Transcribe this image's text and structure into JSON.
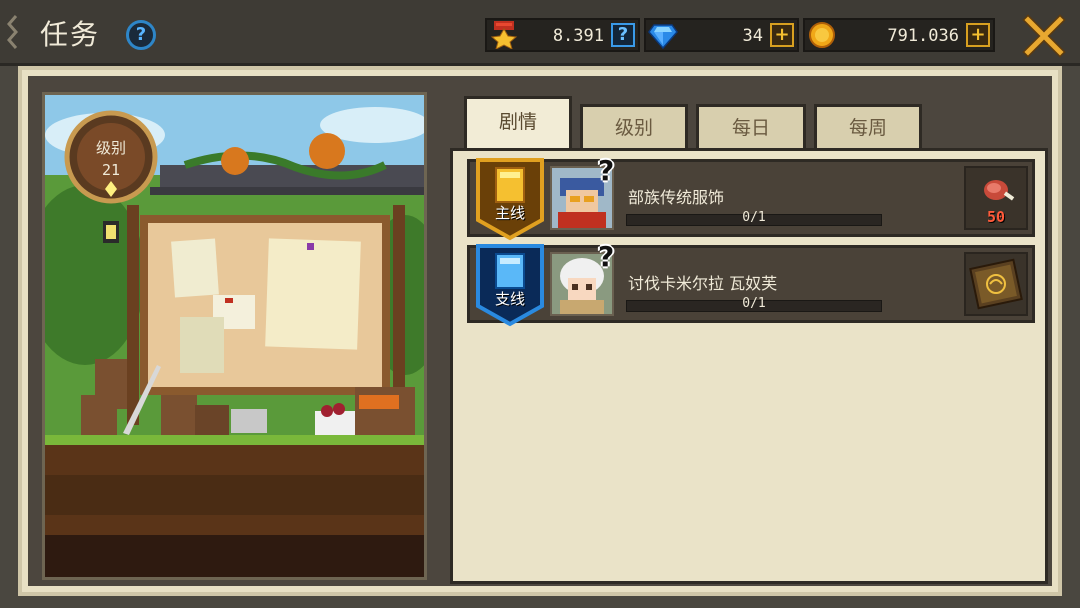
{
  "header": {
    "title": "任务",
    "help_label": "?",
    "resources": [
      {
        "name": "medal",
        "value": "8.391",
        "button": "?"
      },
      {
        "name": "gem",
        "value": "34",
        "button": "+"
      },
      {
        "name": "coin",
        "value": "791.036",
        "button": "+"
      }
    ],
    "close_icon": "close-x-icon"
  },
  "scene": {
    "level_label": "级别",
    "level_value": "21"
  },
  "tabs": [
    {
      "label": "剧情",
      "active": true
    },
    {
      "label": "级别",
      "active": false
    },
    {
      "label": "每日",
      "active": false
    },
    {
      "label": "每周",
      "active": false
    }
  ],
  "quests": [
    {
      "type": "主线",
      "badge_color": "#e0a020",
      "name": "部族传统服饰",
      "progress": "0/1",
      "progress_fraction": 0,
      "reward_icon": "meat-icon",
      "reward_amount": "50"
    },
    {
      "type": "支线",
      "badge_color": "#2a8ae0",
      "name": "讨伐卡米尔拉 瓦奴芙",
      "progress": "0/1",
      "progress_fraction": 0,
      "reward_icon": "spellbook-icon",
      "reward_amount": ""
    }
  ],
  "colors": {
    "accent_gold": "#d8a020",
    "accent_blue": "#2a8ae0",
    "panel": "#eae3c8"
  }
}
